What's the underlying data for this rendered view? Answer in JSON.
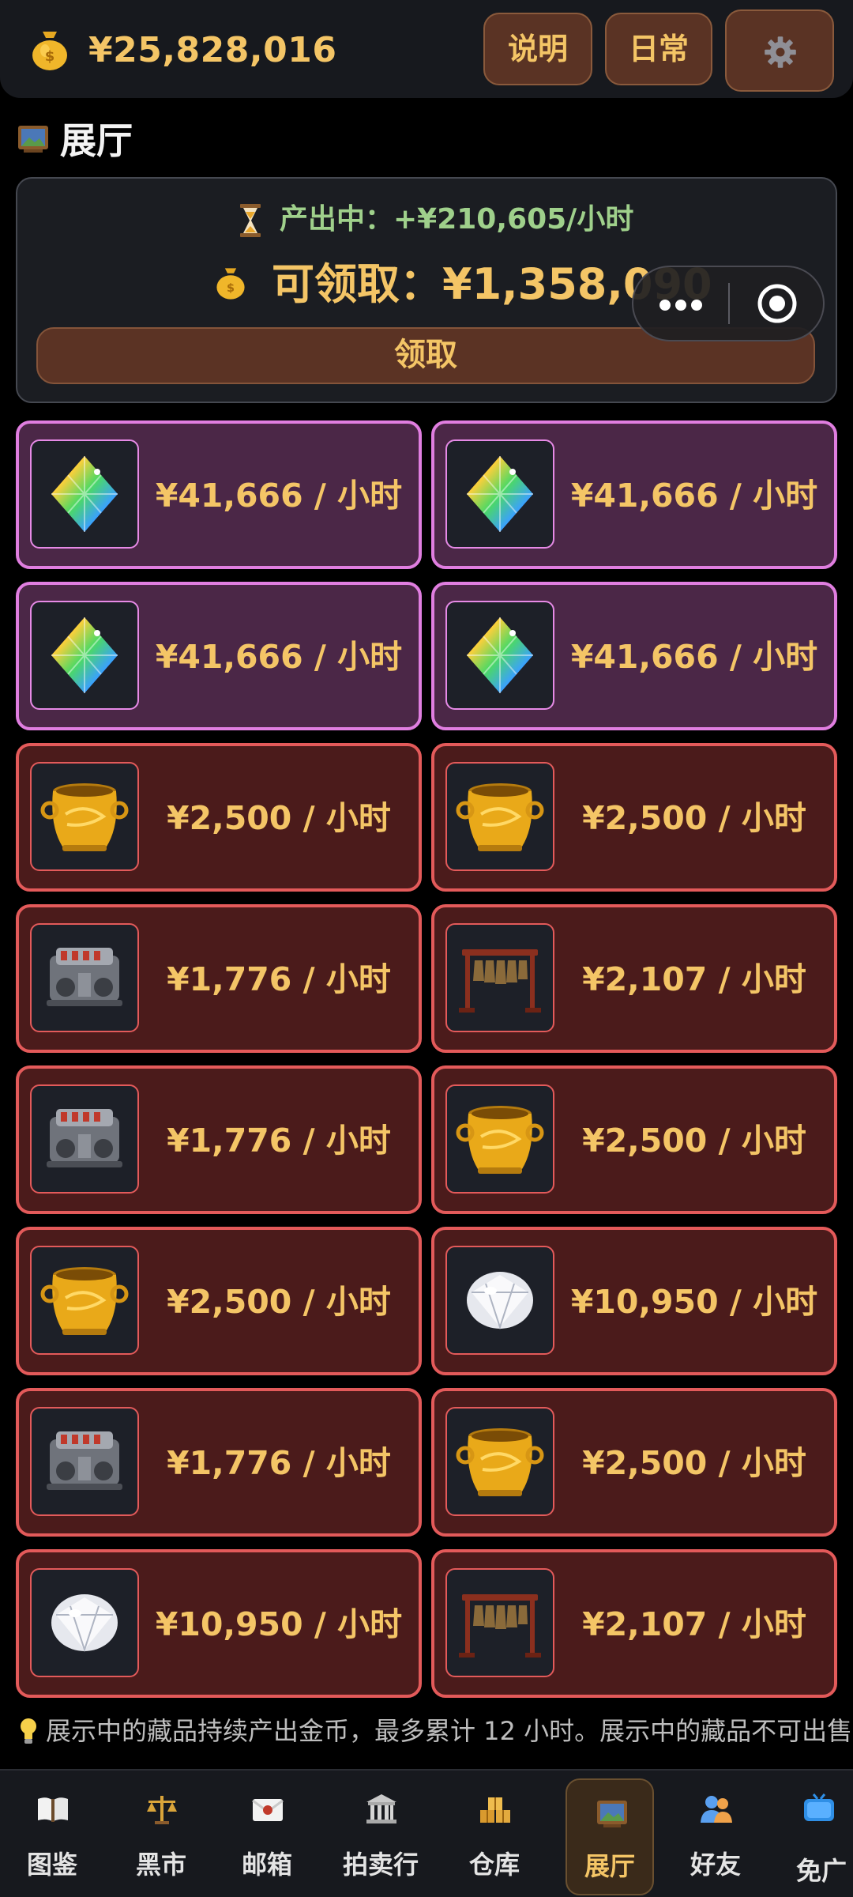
{
  "header": {
    "balance": "¥25,828,016",
    "btn_help": "说明",
    "btn_daily": "日常",
    "settings_icon": "gear-icon"
  },
  "section": {
    "title": "展厅",
    "icon": "gallery-icon"
  },
  "summary": {
    "producing": "产出中：+¥210,605/小时",
    "claimable": "可领取：¥1,358,090",
    "claim_button": "领取"
  },
  "cards": [
    {
      "item": "rainbow-gem",
      "rarity": "rare",
      "rate": "¥41,666 / 小时"
    },
    {
      "item": "rainbow-gem",
      "rarity": "rare",
      "rate": "¥41,666 / 小时"
    },
    {
      "item": "rainbow-gem",
      "rarity": "rare",
      "rate": "¥41,666 / 小时"
    },
    {
      "item": "rainbow-gem",
      "rarity": "rare",
      "rate": "¥41,666 / 小时"
    },
    {
      "item": "golden-pot",
      "rarity": "epic",
      "rate": "¥2,500 / 小时"
    },
    {
      "item": "golden-pot",
      "rarity": "epic",
      "rate": "¥2,500 / 小时"
    },
    {
      "item": "engine",
      "rarity": "epic",
      "rate": "¥1,776 / 小时"
    },
    {
      "item": "chime-bells",
      "rarity": "epic",
      "rate": "¥2,107 / 小时"
    },
    {
      "item": "engine",
      "rarity": "epic",
      "rate": "¥1,776 / 小时"
    },
    {
      "item": "golden-pot",
      "rarity": "epic",
      "rate": "¥2,500 / 小时"
    },
    {
      "item": "golden-pot",
      "rarity": "epic",
      "rate": "¥2,500 / 小时"
    },
    {
      "item": "diamond",
      "rarity": "epic",
      "rate": "¥10,950 / 小时"
    },
    {
      "item": "engine",
      "rarity": "epic",
      "rate": "¥1,776 / 小时"
    },
    {
      "item": "golden-pot",
      "rarity": "epic",
      "rate": "¥2,500 / 小时"
    },
    {
      "item": "diamond",
      "rarity": "epic",
      "rate": "¥10,950 / 小时"
    },
    {
      "item": "chime-bells",
      "rarity": "epic",
      "rate": "¥2,107 / 小时"
    }
  ],
  "footnote": "展示中的藏品持续产出金币，最多累计 12 小时。展示中的藏品不可出售",
  "nav": [
    {
      "label": "图鉴",
      "icon": "book-icon"
    },
    {
      "label": "黑市",
      "icon": "scale-icon"
    },
    {
      "label": "邮箱",
      "icon": "mail-icon"
    },
    {
      "label": "拍卖行",
      "icon": "auction-house-icon"
    },
    {
      "label": "仓库",
      "icon": "boxes-icon"
    },
    {
      "label": "展厅",
      "icon": "gallery-icon",
      "active": true
    },
    {
      "label": "好友",
      "icon": "friends-icon"
    },
    {
      "label": "免广",
      "icon": "tv-icon"
    }
  ]
}
